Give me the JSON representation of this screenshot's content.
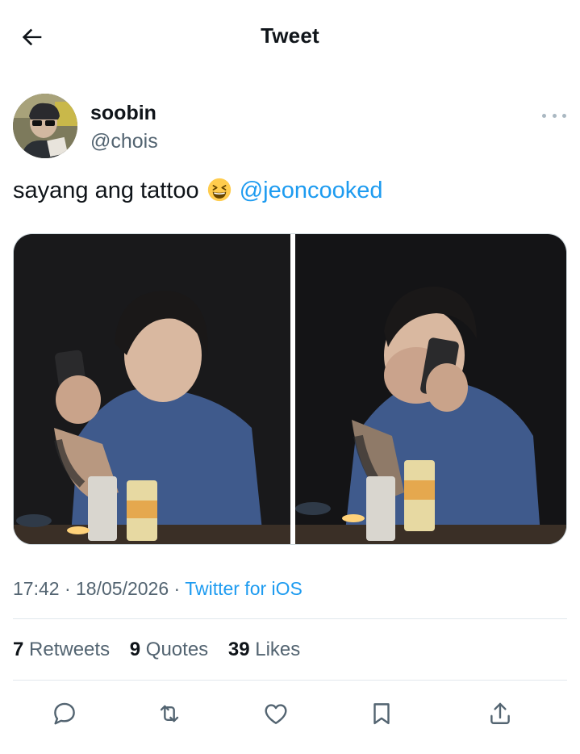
{
  "header": {
    "title": "Tweet",
    "back_icon": "arrow-left-icon"
  },
  "author": {
    "name": "soobin",
    "handle": "@chois",
    "avatar": "user-avatar",
    "more_icon": "more-horizontal-icon"
  },
  "tweet": {
    "text": "sayang ang tattoo ",
    "emoji": "grinning-squinting-face-emoji",
    "mention": "@jeoncooked",
    "photos": [
      "photo-man-with-phone-smiling",
      "photo-man-covering-face-with-hand"
    ]
  },
  "meta": {
    "time": "17:42",
    "date": "18/05/2026",
    "separator": "·",
    "source": "Twitter for iOS"
  },
  "stats": {
    "retweets_count": "7",
    "retweets_label": "Retweets",
    "quotes_count": "9",
    "quotes_label": "Quotes",
    "likes_count": "39",
    "likes_label": "Likes"
  },
  "actions": [
    "reply-icon",
    "retweet-icon",
    "like-icon",
    "bookmark-icon",
    "share-icon"
  ],
  "colors": {
    "link": "#1d9bf0",
    "secondary_text": "#536471",
    "primary_text": "#0f1419",
    "divider": "#e1e8ed"
  }
}
